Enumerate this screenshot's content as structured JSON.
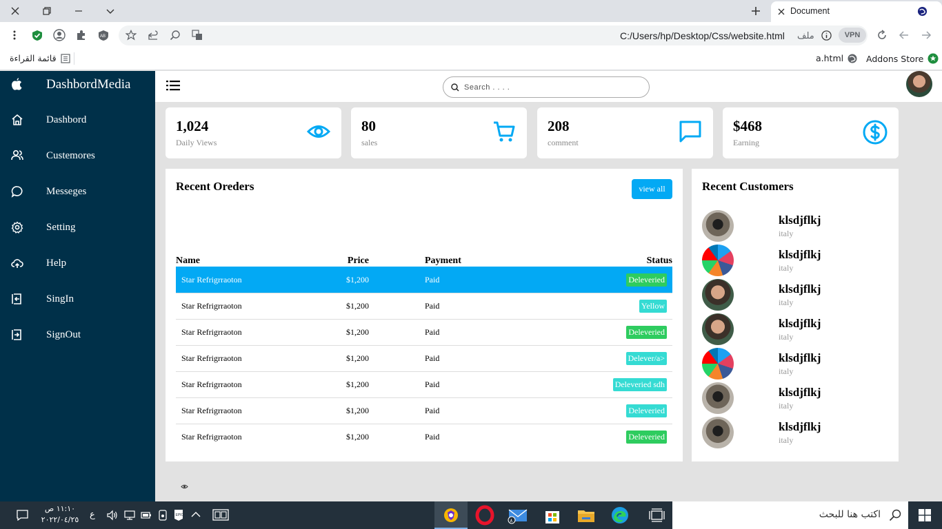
{
  "browser": {
    "tab_title": "Document",
    "url": "C:/Users/hp/Desktop/Css/website.html",
    "file_label": "ملف",
    "vpn_label": "VPN",
    "bookmarks": {
      "reading_list": "قائمة القراءة",
      "a_html": "a.html",
      "addons_store": "Addons Store"
    }
  },
  "sidebar": {
    "brand": "DashbordMedia",
    "items": [
      {
        "label": "Dashbord",
        "icon": "home-icon"
      },
      {
        "label": "Custemores",
        "icon": "users-icon"
      },
      {
        "label": "Messeges",
        "icon": "chat-icon"
      },
      {
        "label": "Setting",
        "icon": "gear-icon"
      },
      {
        "label": "Help",
        "icon": "cloud-icon"
      },
      {
        "label": "SingIn",
        "icon": "sign-in-icon"
      },
      {
        "label": "SignOut",
        "icon": "sign-out-icon"
      }
    ]
  },
  "header": {
    "search_placeholder": "Search . . . ."
  },
  "cards": [
    {
      "value": "1,024",
      "caption": "Daily Views",
      "icon": "eye-icon"
    },
    {
      "value": "80",
      "caption": "sales",
      "icon": "cart-icon"
    },
    {
      "value": "208",
      "caption": "comment",
      "icon": "comment-icon"
    },
    {
      "value": "$468",
      "caption": "Earning",
      "icon": "dollar-icon"
    }
  ],
  "orders": {
    "title": "Recent Oreders",
    "view_all": "view all",
    "columns": [
      "Name",
      "Price",
      "Payment",
      "Status"
    ],
    "rows": [
      {
        "name": "Star Refrigrraoton",
        "price": "$1,200",
        "payment": "Paid",
        "status": "Deleveried",
        "status_color": "#2ecc5f"
      },
      {
        "name": "Star Refrigrraoton",
        "price": "$1,200",
        "payment": "Paid",
        "status": "Yellow",
        "status_color": "#35dbd3"
      },
      {
        "name": "Star Refrigrraoton",
        "price": "$1,200",
        "payment": "Paid",
        "status": "Deleveried",
        "status_color": "#2ecc5f"
      },
      {
        "name": "Star Refrigrraoton",
        "price": "$1,200",
        "payment": "Paid",
        "status": "Delever/a>",
        "status_color": "#35dbd3"
      },
      {
        "name": "Star Refrigrraoton",
        "price": "$1,200",
        "payment": "Paid",
        "status": "Deleveried sdh",
        "status_color": "#35dbd3"
      },
      {
        "name": "Star Refrigrraoton",
        "price": "$1,200",
        "payment": "Paid",
        "status": "Deleveried",
        "status_color": "#35dbd3"
      },
      {
        "name": "Star Refrigrraoton",
        "price": "$1,200",
        "payment": "Paid",
        "status": "Deleveried",
        "status_color": "#2ecc5f"
      }
    ]
  },
  "customers": {
    "title": "Recent Customers",
    "list": [
      {
        "name": "klsdjflkj",
        "country": "italy"
      },
      {
        "name": "klsdjflkj",
        "country": "italy"
      },
      {
        "name": "klsdjflkj",
        "country": "italy"
      },
      {
        "name": "klsdjflkj",
        "country": "italy"
      },
      {
        "name": "klsdjflkj",
        "country": "italy"
      },
      {
        "name": "klsdjflkj",
        "country": "italy"
      },
      {
        "name": "klsdjflkj",
        "country": "italy"
      }
    ]
  },
  "taskbar": {
    "time": "١١:١٠ ص",
    "date": "٢٠٢٢/٠٤/٢٥",
    "lang": "ع",
    "search_text": "اكتب هنا للبحث"
  },
  "colors": {
    "sidebar": "#003049",
    "accent": "#03a9f4",
    "green_badge": "#2ecc5f",
    "teal_badge": "#35dbd3"
  }
}
